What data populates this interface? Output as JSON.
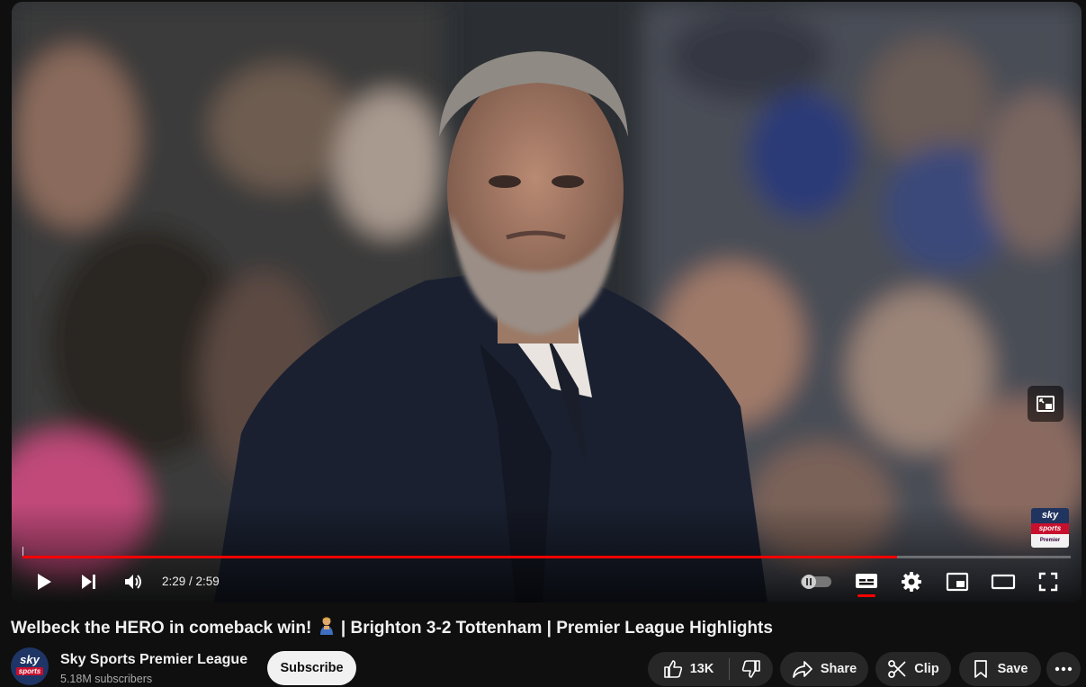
{
  "player": {
    "time_label": "2:29 / 2:59",
    "played_fraction": 0.834,
    "loaded_fraction": 0.834,
    "brand_sky": "sky",
    "brand_sports": "sports",
    "brand_league": "Premier League",
    "controls": [
      "play-icon",
      "next-icon",
      "volume-icon",
      "autoplay-toggle",
      "subtitles-icon",
      "settings-icon",
      "miniplayer-icon",
      "theater-icon",
      "fullscreen-icon"
    ]
  },
  "video": {
    "title_part1": "Welbeck the HERO in comeback win! ",
    "title_emoji": "person-celebrating-emoji",
    "title_part2": " | Brighton 3-2 Tottenham | Premier League Highlights"
  },
  "channel": {
    "avatar_sky": "sky",
    "avatar_sports": "sports",
    "name": "Sky Sports Premier League",
    "subscribers": "5.18M subscribers",
    "subscribe_label": "Subscribe"
  },
  "actions": {
    "like_count": "13K",
    "share_label": "Share",
    "clip_label": "Clip",
    "save_label": "Save"
  },
  "colors": {
    "accent": "#ff0000",
    "background": "#0f0f0f",
    "pill": "#272727"
  }
}
